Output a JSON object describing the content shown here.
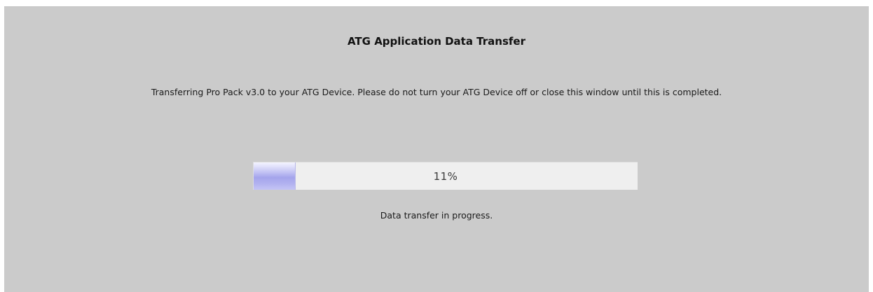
{
  "dialog": {
    "title": "ATG Application Data Transfer",
    "message": "Transferring Pro Pack v3.0 to your ATG Device. Please do not turn your ATG Device off or close this window until this is completed.",
    "progress": {
      "percent_label": "11%",
      "fraction": 0.11
    },
    "status": "Data transfer in progress."
  },
  "colors": {
    "panel_background": "#cbcbcb",
    "progress_track": "#efefef",
    "progress_fill": "#a4a4ec"
  }
}
